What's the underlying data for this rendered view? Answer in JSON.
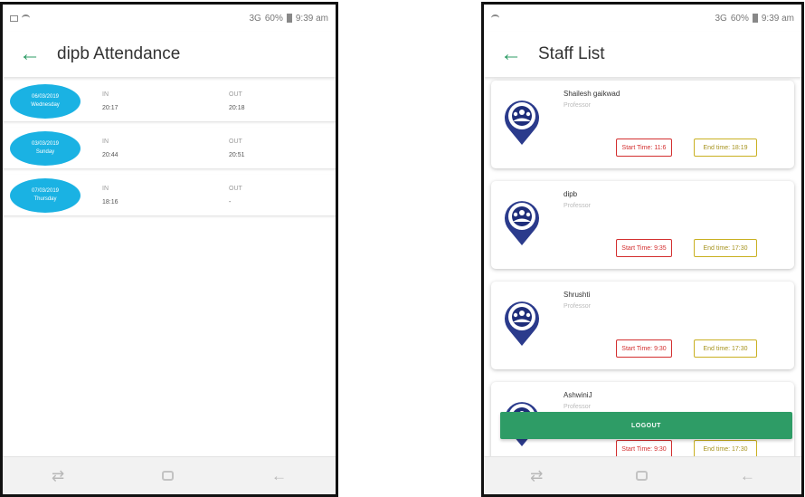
{
  "attendance_screen": {
    "status": {
      "network": "3G",
      "battery": "60%",
      "time": "9:39 am"
    },
    "title": "dipb Attendance",
    "records": [
      {
        "date": "06/03/2019",
        "day": "Wednesday",
        "in_label": "IN",
        "in_time": "20:17",
        "out_label": "OUT",
        "out_time": "20:18"
      },
      {
        "date": "03/03/2019",
        "day": "Sunday",
        "in_label": "IN",
        "in_time": "20:44",
        "out_label": "OUT",
        "out_time": "20:51"
      },
      {
        "date": "07/03/2019",
        "day": "Thursday",
        "in_label": "IN",
        "in_time": "18:16",
        "out_label": "OUT",
        "out_time": "-"
      }
    ]
  },
  "staff_screen": {
    "status": {
      "network": "3G",
      "battery": "60%",
      "time": "9:39 am"
    },
    "title": "Staff List",
    "staff": [
      {
        "name": "Shailesh gaikwad",
        "role": "Professor",
        "start": "Start Time: 11:6",
        "end": "End time: 18:19"
      },
      {
        "name": "dipb",
        "role": "Professor",
        "start": "Start Time: 9:35",
        "end": "End time: 17:30"
      },
      {
        "name": "Shrushti",
        "role": "Professor",
        "start": "Start Time: 9:30",
        "end": "End time: 17:30"
      },
      {
        "name": "AshwiniJ",
        "role": "Professor",
        "start": "Start Time: 9:30",
        "end": "End time: 17:30"
      }
    ],
    "logout_label": "LOGOUT"
  },
  "colors": {
    "accent_green": "#2e9c66",
    "date_blue": "#1ab2e3",
    "start_red": "#d32f2f",
    "end_gold": "#c9b021"
  },
  "icons": [
    "back-arrow-icon",
    "recent-apps-icon",
    "home-icon",
    "back-nav-icon",
    "staff-location-icon"
  ]
}
